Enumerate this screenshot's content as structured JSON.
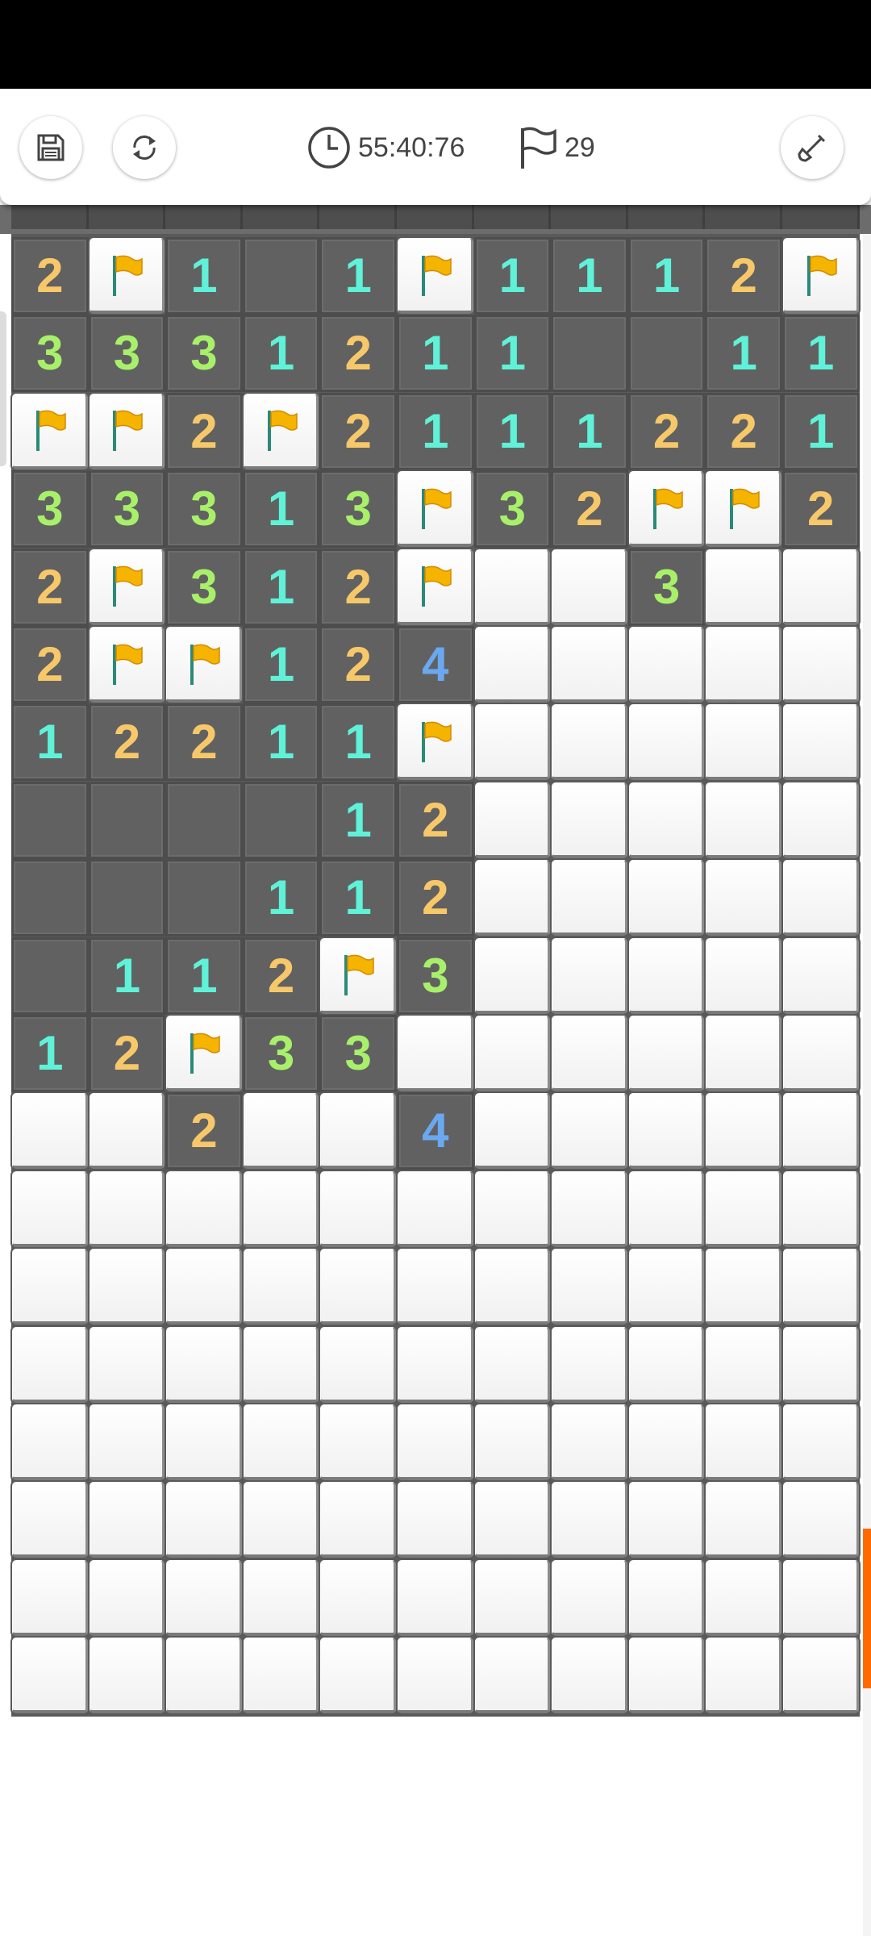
{
  "toolbar": {
    "save_icon": "save-icon",
    "restart_icon": "restart-icon",
    "timer_icon": "clock-icon",
    "timer": "55:40:76",
    "flag_icon": "flag-outline-icon",
    "flags_count": "29",
    "tool_icon": "shovel-icon"
  },
  "board": {
    "columns": 11,
    "legend": "R=revealed empty, F=flag, C=covered, digits=revealed number",
    "rows": [
      [
        "2",
        "F",
        "1",
        "R",
        "1",
        "F",
        "1",
        "1",
        "1",
        "2",
        "F"
      ],
      [
        "3",
        "3",
        "3",
        "1",
        "2",
        "1",
        "1",
        "R",
        "R",
        "1",
        "1"
      ],
      [
        "F",
        "F",
        "2",
        "F",
        "2",
        "1",
        "1",
        "1",
        "2",
        "2",
        "1"
      ],
      [
        "3",
        "3",
        "3",
        "1",
        "3",
        "F",
        "3",
        "2",
        "F",
        "F",
        "2"
      ],
      [
        "2",
        "F",
        "3",
        "1",
        "2",
        "F",
        "C",
        "C",
        "3",
        "C",
        "C"
      ],
      [
        "2",
        "F",
        "F",
        "1",
        "2",
        "4",
        "C",
        "C",
        "C",
        "C",
        "C"
      ],
      [
        "1",
        "2",
        "2",
        "1",
        "1",
        "F",
        "C",
        "C",
        "C",
        "C",
        "C"
      ],
      [
        "R",
        "R",
        "R",
        "R",
        "1",
        "2",
        "C",
        "C",
        "C",
        "C",
        "C"
      ],
      [
        "R",
        "R",
        "R",
        "1",
        "1",
        "2",
        "C",
        "C",
        "C",
        "C",
        "C"
      ],
      [
        "R",
        "1",
        "1",
        "2",
        "F",
        "3",
        "C",
        "C",
        "C",
        "C",
        "C"
      ],
      [
        "1",
        "2",
        "F",
        "3",
        "3",
        "C",
        "C",
        "C",
        "C",
        "C",
        "C"
      ],
      [
        "C",
        "C",
        "2",
        "C",
        "C",
        "4",
        "C",
        "C",
        "C",
        "C",
        "C"
      ],
      [
        "C",
        "C",
        "C",
        "C",
        "C",
        "C",
        "C",
        "C",
        "C",
        "C",
        "C"
      ],
      [
        "C",
        "C",
        "C",
        "C",
        "C",
        "C",
        "C",
        "C",
        "C",
        "C",
        "C"
      ],
      [
        "C",
        "C",
        "C",
        "C",
        "C",
        "C",
        "C",
        "C",
        "C",
        "C",
        "C"
      ],
      [
        "C",
        "C",
        "C",
        "C",
        "C",
        "C",
        "C",
        "C",
        "C",
        "C",
        "C"
      ],
      [
        "C",
        "C",
        "C",
        "C",
        "C",
        "C",
        "C",
        "C",
        "C",
        "C",
        "C"
      ],
      [
        "C",
        "C",
        "C",
        "C",
        "C",
        "C",
        "C",
        "C",
        "C",
        "C",
        "C"
      ],
      [
        "C",
        "C",
        "C",
        "C",
        "C",
        "C",
        "C",
        "C",
        "C",
        "C",
        "C"
      ]
    ]
  },
  "colors": {
    "num_1": "#5ff2d8",
    "num_2": "#f7c86a",
    "num_3": "#a8f06a",
    "num_4": "#6aa8f0",
    "flag": "#f5b400",
    "scroll_thumb": "#ff6a00"
  }
}
